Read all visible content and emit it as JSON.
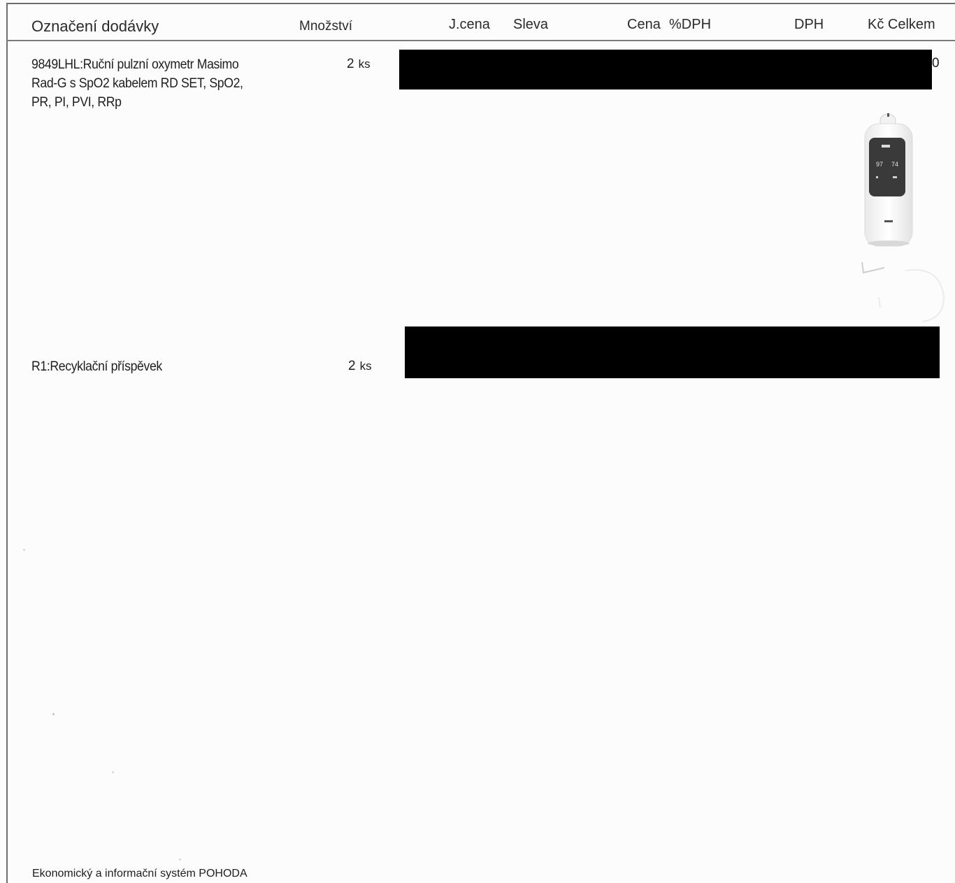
{
  "table": {
    "headers": {
      "designation": "Označení dodávky",
      "quantity": "Množství",
      "unit_price": "J.cena",
      "discount": "Sleva",
      "price": "Cena",
      "vat_percent": "%DPH",
      "vat": "DPH",
      "total": "Kč Celkem"
    },
    "rows": [
      {
        "description_lines": [
          "9849LHL:Ruční pulzní oxymetr Masimo",
          "Rad-G s SpO2 kabelem RD SET, SpO2,",
          "PR, PI, PVI, RRp"
        ],
        "quantity": "2",
        "unit": "ks",
        "trailing_glyph": "0"
      },
      {
        "description_lines": [
          "R1:Recyklační příspěvek"
        ],
        "quantity": "2",
        "unit": "ks"
      }
    ]
  },
  "product_image": {
    "icon": "pulse-oximeter-device-photo",
    "screen_readout": [
      "97",
      "74"
    ]
  },
  "footer": {
    "text": "Ekonomický a informační systém POHODA"
  }
}
